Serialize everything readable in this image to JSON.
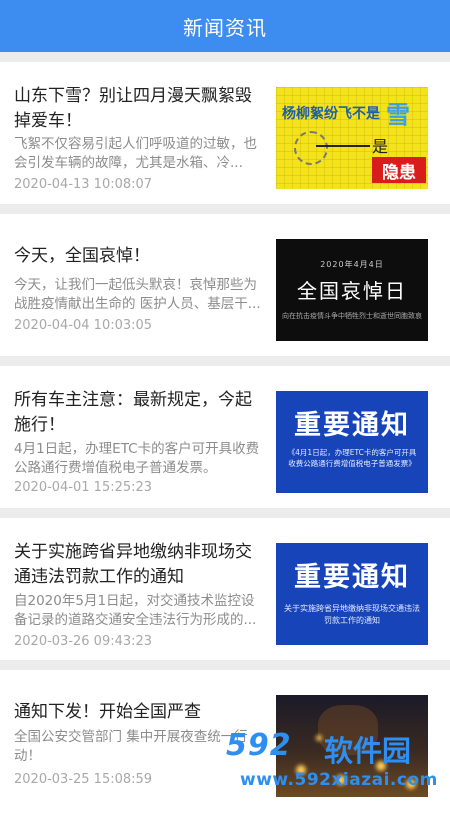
{
  "header": {
    "title": "新闻资讯"
  },
  "news": [
    {
      "title": "山东下雪？别让四月漫天飘絮毁掉爱车！",
      "summary": "飞絮不仅容易引起人们呼吸道的过敏，也会引发车辆的故障，尤其是水箱、冷...",
      "time": "2020-04-13 10:08:07",
      "thumb": {
        "line1": "杨柳絮纷飞不是",
        "line2": "雪",
        "line3": "是",
        "line4": "隐患"
      }
    },
    {
      "title": "今天，全国哀悼！",
      "summary": "今天，让我们一起低头默哀！哀悼那些为战胜疫情献出生命的 医护人员、基层干...",
      "time": "2020-04-04 10:03:05",
      "thumb": {
        "date": "2020年4月4日",
        "main": "全国哀悼日",
        "sub": "向在抗击疫情斗争中牺牲烈士和逝世同胞致哀"
      }
    },
    {
      "title": "所有车主注意：最新规定，今起施行！",
      "summary": "4月1日起，办理ETC卡的客户可开具收费公路通行费增值税电子普通发票。",
      "time": "2020-04-01 15:25:23",
      "thumb": {
        "main": "重要通知",
        "sub": "《4月1日起，办理ETC卡的客户可开具收费公路通行费增值税电子普通发票》"
      }
    },
    {
      "title": "关于实施跨省异地缴纳非现场交通违法罚款工作的通知",
      "summary": "自2020年5月1日起，对交通技术监控设备记录的道路交通安全违法行为形成的...",
      "time": "2020-03-26 09:43:23",
      "thumb": {
        "main": "重要通知",
        "sub": "关于实施跨省异地缴纳非现场交通违法罚款工作的通知"
      }
    },
    {
      "title": "通知下发！开始全国严查",
      "summary": "全国公安交管部门 集中开展夜查统一行动！",
      "time": "2020-03-25 15:08:59",
      "thumb": {}
    }
  ],
  "watermark": {
    "logo": "592",
    "logo2": "软件园",
    "url": "www.592xiazai.com"
  },
  "colors": {
    "header_bg": "#3d8cf0",
    "notice_blue": "#1744b8",
    "watermark_blue": "#2f8ff0"
  }
}
